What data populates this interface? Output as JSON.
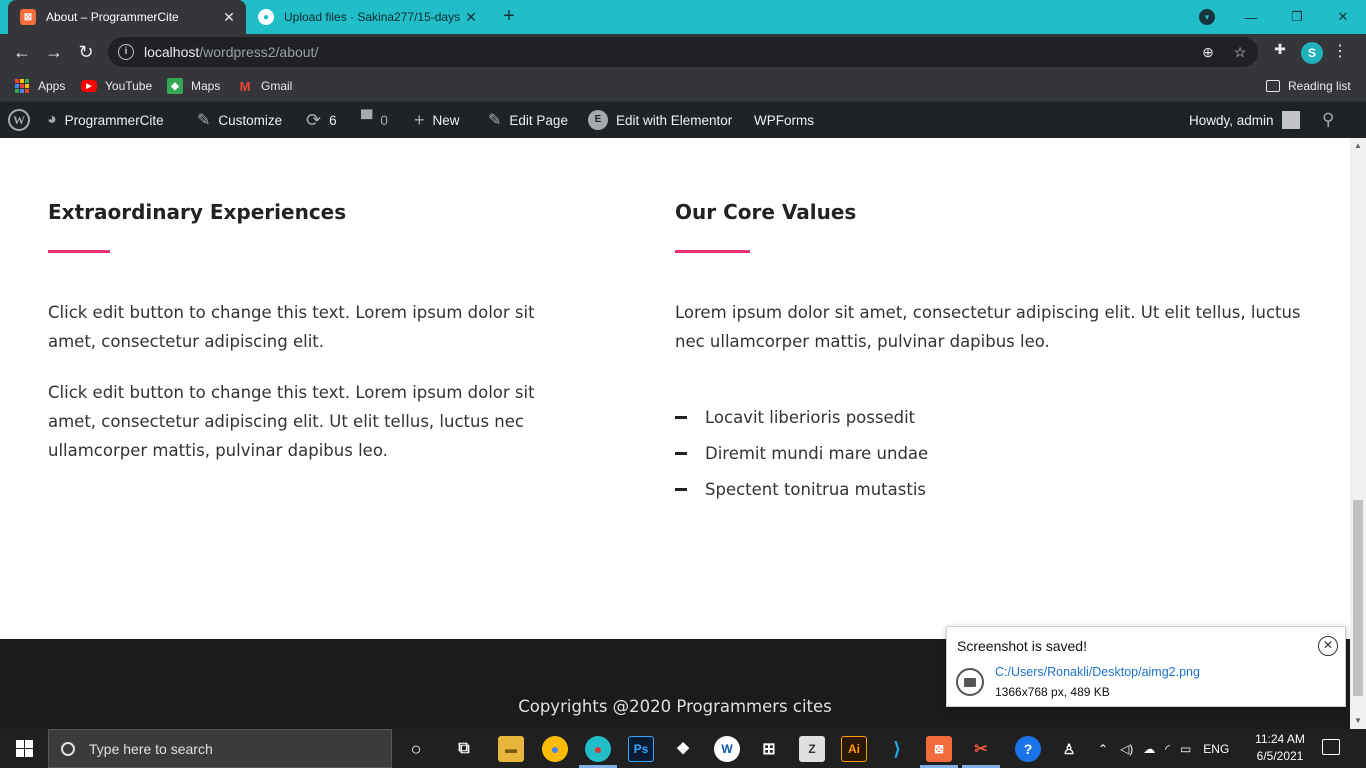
{
  "browser": {
    "tabs": [
      {
        "title": "About – ProgrammerCite",
        "favicon": "xampp-favicon-icon",
        "active": true
      },
      {
        "title": "Upload files · Sakina277/15-days",
        "favicon": "github-favicon-icon",
        "active": false
      }
    ],
    "url_host": "localhost",
    "url_path": "/wordpress2/about/",
    "profile_initial": "S",
    "accent_color": "#21bdc9"
  },
  "bookmarks": {
    "items": [
      {
        "label": "Apps",
        "icon": "apps-grid-icon"
      },
      {
        "label": "YouTube",
        "icon": "youtube-icon"
      },
      {
        "label": "Maps",
        "icon": "maps-icon"
      },
      {
        "label": "Gmail",
        "icon": "gmail-icon"
      }
    ],
    "reading_list": "Reading list"
  },
  "adminbar": {
    "site_name": "ProgrammerCite",
    "customize": "Customize",
    "updates_count": "6",
    "comments_count": "0",
    "new": "New",
    "edit_page": "Edit Page",
    "edit_elementor": "Edit with Elementor",
    "wpforms": "WPForms",
    "howdy": "Howdy, admin"
  },
  "content": {
    "left": {
      "heading": "Extraordinary Experiences",
      "paragraphs": [
        "Click edit button to change this text. Lorem ipsum dolor sit amet, consectetur adipiscing elit.",
        "Click edit button to change this text. Lorem ipsum dolor sit amet, consectetur adipiscing elit. Ut elit tellus, luctus nec ullamcorper mattis, pulvinar dapibus leo."
      ]
    },
    "right": {
      "heading": "Our Core Values",
      "paragraph": "Lorem ipsum dolor sit amet, consectetur adipiscing elit. Ut elit tellus, luctus nec ullamcorper mattis, pulvinar dapibus leo.",
      "list": [
        "Locavit liberioris possedit",
        "Diremit mundi mare undae",
        "Spectent tonitrua mutastis"
      ]
    },
    "accent_color": "#e7336b"
  },
  "footer": {
    "copyright": "Copyrights @2020 Programmers cites"
  },
  "toast": {
    "title": "Screenshot is saved!",
    "path": "C:/Users/Ronakli/Desktop/aimg2.png",
    "meta": "1366x768 px, 489 KB"
  },
  "taskbar": {
    "search_placeholder": "Type here to search",
    "language": "ENG",
    "time": "11:24 AM",
    "date": "6/5/2021"
  }
}
